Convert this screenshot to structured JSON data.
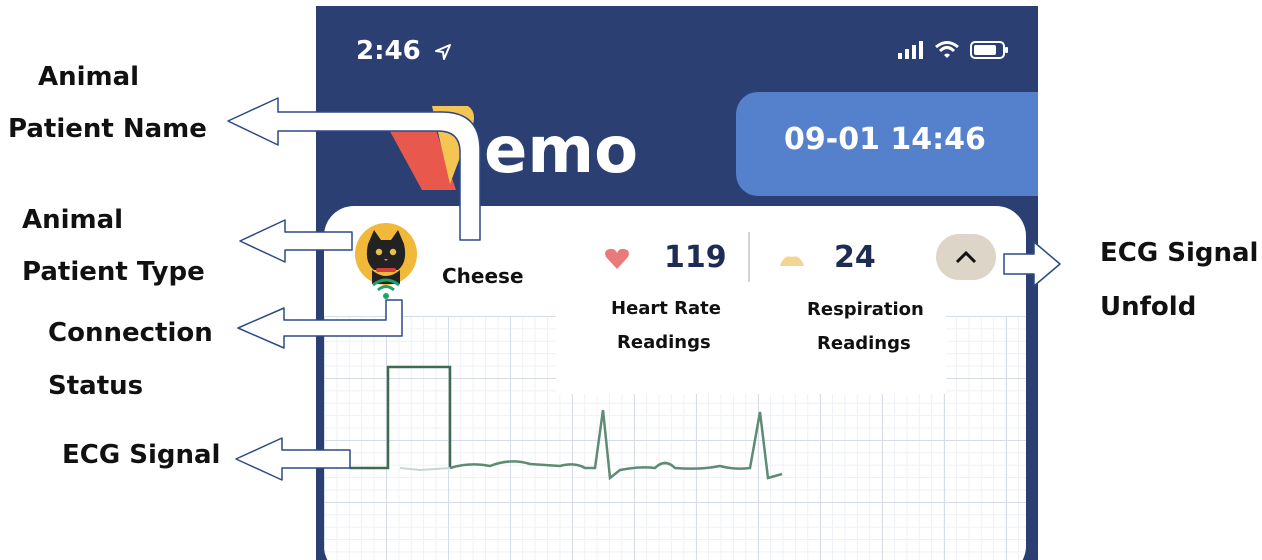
{
  "status_bar": {
    "time": "2:46",
    "location_icon": "location-arrow-icon",
    "signal_icon": "cellular-signal-icon",
    "wifi_icon": "wifi-icon",
    "battery_icon": "battery-icon"
  },
  "header": {
    "logo_text": "emo",
    "datetime": "09-01 14:46"
  },
  "patient": {
    "name": "Cheese",
    "avatar_icon": "black-cat-icon",
    "connection_icon": "wifi-connected-icon"
  },
  "vitals": {
    "heart_rate": "119",
    "heart_icon": "heart-icon",
    "respiration": "24",
    "lung_icon": "lung-icon",
    "heart_rate_label_1": "Heart Rate",
    "heart_rate_label_2": "Readings",
    "respiration_label_1": "Respiration",
    "respiration_label_2": "Readings"
  },
  "expand_button": {
    "icon": "chevron-up-icon"
  },
  "annotations": {
    "animal_name_1": "Animal",
    "animal_name_2": "Patient Name",
    "animal_type_1": "Animal",
    "animal_type_2": "Patient Type",
    "connection_1": "Connection",
    "connection_2": "Status",
    "ecg_signal": "ECG Signal",
    "ecg_unfold_1": "ECG Signal",
    "ecg_unfold_2": "Unfold"
  },
  "colors": {
    "header_bg": "#2b3f73",
    "date_pill": "#5480cc",
    "ecg_trace": "#3d6b52",
    "connection": "#1fa36a"
  }
}
